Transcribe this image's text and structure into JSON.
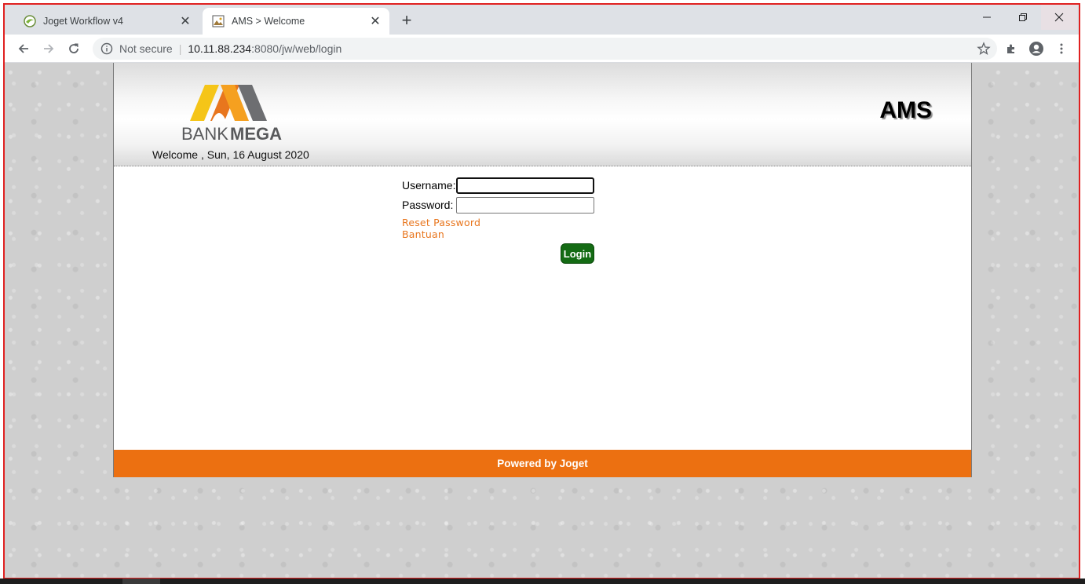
{
  "browser": {
    "tabs": [
      {
        "title": "Joget Workflow v4",
        "favicon": "joget-icon",
        "active": false
      },
      {
        "title": "AMS  >  Welcome",
        "favicon": "page-image-icon",
        "active": true
      }
    ],
    "new_tab_icon": "plus-icon",
    "window_controls": [
      "minimize-icon",
      "restore-icon",
      "close-icon"
    ],
    "address": {
      "security_label": "Not secure",
      "host": "10.11.88.234",
      "path": ":8080/jw/web/login"
    },
    "nav_icons": [
      "back-arrow-icon",
      "forward-arrow-icon",
      "reload-icon"
    ],
    "toolbar_icons": [
      "star-icon",
      "extensions-icon",
      "account-icon",
      "menu-icon"
    ]
  },
  "page": {
    "logo_text_left": "BANK",
    "logo_text_right": "MEGA",
    "welcome": "Welcome , Sun, 16 August 2020",
    "app_name": "AMS",
    "login": {
      "username_label": "Username:",
      "username_value": "",
      "password_label": "Password:",
      "password_value": "",
      "reset_password": "Reset Password",
      "help": "Bantuan",
      "login_button": "Login"
    },
    "footer": "Powered by Joget"
  },
  "colors": {
    "accent_orange": "#ec7011",
    "link_orange": "#e8761e",
    "login_green": "#146b14",
    "logo_yellow": "#f5c518",
    "logo_gray": "#6d6e71",
    "frame_red": "#e02020"
  }
}
